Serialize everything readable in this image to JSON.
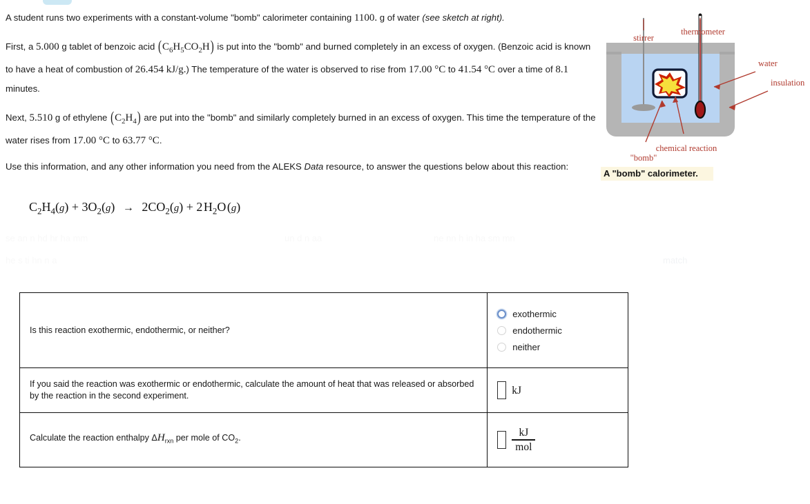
{
  "problem": {
    "p1_a": "A student runs two experiments with a constant-volume \"bomb\" calorimeter containing ",
    "p1_mass": "1100.",
    "p1_b": " g of water ",
    "p1_italic": "(see sketch at right).",
    "p2_a": "First, a ",
    "p2_mass": "5.000",
    "p2_b": " g tablet of benzoic acid ",
    "p2_formula_parts": [
      "C",
      "6",
      "H",
      "5",
      "CO",
      "2",
      "H"
    ],
    "p2_c": " is put into the \"bomb\" and burned completely in an excess of oxygen. (Benzoic acid is known to have a heat of combustion of ",
    "p2_heat": "26.454",
    "p2_units": " kJ/g.",
    "p2_d": ") The temperature of the water is observed to rise from ",
    "p2_t1": "17.00",
    "p2_degc": " °C",
    "p2_e": " to ",
    "p2_t2": "41.54",
    "p2_f": " over a time of ",
    "p2_time": "8.1",
    "p2_g": " minutes.",
    "p3_a": "Next, ",
    "p3_mass": "5.510",
    "p3_b": " g of ethylene ",
    "p3_formula_parts": [
      "C",
      "2",
      "H",
      "4"
    ],
    "p3_c": " are put into the \"bomb\" and similarly completely burned in an excess of oxygen. This time the temperature of the water rises from ",
    "p3_t1": "17.00",
    "p3_t2": "63.77",
    "p4": "Use this information, and any other information you need from the ALEKS ",
    "p4_italic": "Data",
    "p4_b": " resource, to answer the questions below about this reaction:"
  },
  "equation": {
    "reactant1": "C",
    "reactant1_sub1": "2",
    "reactant1_h": "H",
    "reactant1_sub2": "4",
    "state_g": "g",
    "plus": "+",
    "coeff_o2": "3",
    "o": "O",
    "o_sub": "2",
    "arrow": "→",
    "coeff_co2": "2",
    "co": "CO",
    "co_sub": "2",
    "coeff_h2o": "2",
    "h": "H",
    "h_sub": "2",
    "o_water": "O"
  },
  "figure": {
    "labels": {
      "stirrer": "stirrer",
      "thermometer": "thermometer",
      "water": "water",
      "insulation": "insulation",
      "chemical_reaction": "chemical reaction",
      "bomb": "\"bomb\""
    },
    "caption": "A \"bomb\" calorimeter.",
    "colors": {
      "body": "#b5b5b5",
      "water": "#b9d4f2",
      "label": "#b03a2e",
      "flame_outer": "#cc2200",
      "flame_inner": "#f7e03c",
      "thermometer_fluid": "#a01818",
      "caption_highlight": "#fcf6e0"
    }
  },
  "table": {
    "rows": [
      {
        "question": "Is this reaction exothermic, endothermic, or neither?",
        "type": "radio",
        "options": [
          {
            "label": "exothermic",
            "focused": true
          },
          {
            "label": "endothermic",
            "focused": false
          },
          {
            "label": "neither",
            "focused": false
          }
        ]
      },
      {
        "question": "If you said the reaction was exothermic or endothermic, calculate the amount of heat that was released or absorbed by the reaction in the second experiment.",
        "type": "input",
        "value": "",
        "unit": "kJ"
      },
      {
        "question_pre": "Calculate the reaction enthalpy Δ",
        "question_h": "H",
        "question_sub": "rxn",
        "question_mid": " per mole of CO",
        "question_sub2": "2",
        "question_end": ".",
        "type": "input-fraction",
        "value": "",
        "unit_num": "kJ",
        "unit_den": "mol"
      }
    ]
  },
  "ghost_artifacts": {
    "g1": "se an n hd hr ha mm",
    "g2": "un d n aa",
    "g3": "ne nn h in ha sm mn",
    "g4": "he s ti hn n a",
    "g5": "match"
  }
}
